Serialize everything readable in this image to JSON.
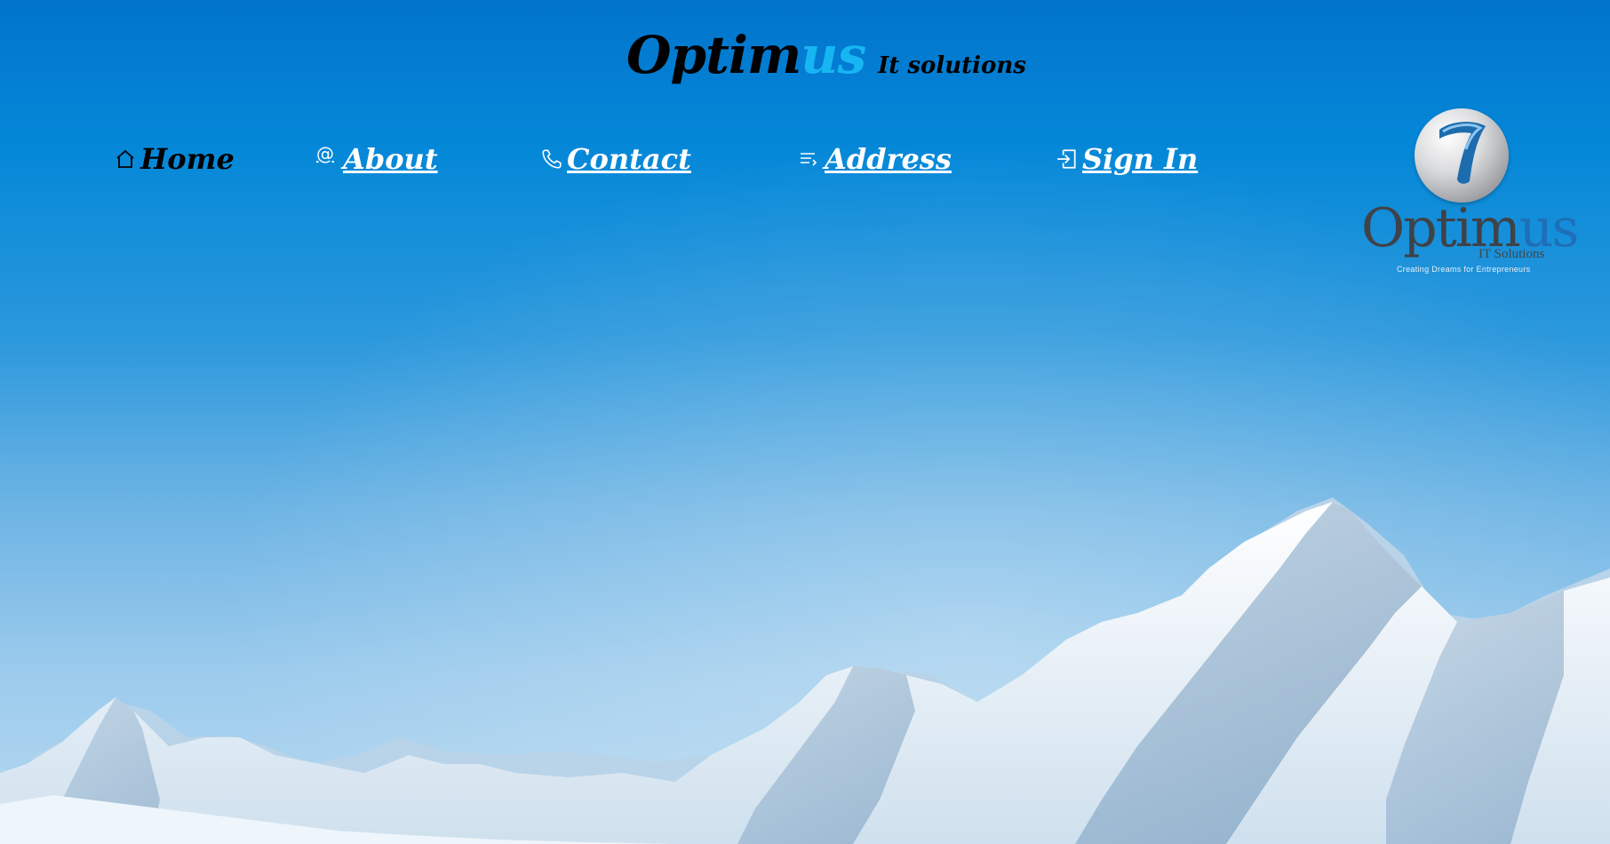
{
  "brand": {
    "name_main": "Optim",
    "name_accent": "us",
    "tagline": "It solutions"
  },
  "nav": {
    "items": [
      {
        "label": "Home",
        "icon": "home-icon"
      },
      {
        "label": " About",
        "icon": "at-icon"
      },
      {
        "label": " Contact",
        "icon": "phone-icon"
      },
      {
        "label": " Address",
        "icon": "list-icon"
      },
      {
        "label": " Sign In",
        "icon": "sign-in-icon"
      }
    ]
  },
  "logo": {
    "word_main": "Optim",
    "word_accent": "us",
    "subtitle": "IT Solutions",
    "tagline": "Creating Dreams for Entrepreneurs"
  },
  "colors": {
    "accent": "#17b6f2",
    "nav_text": "#ffffff",
    "active_nav_text": "#000000",
    "sky_top": "#0174cc",
    "sky_bottom": "#b7d9f1"
  }
}
